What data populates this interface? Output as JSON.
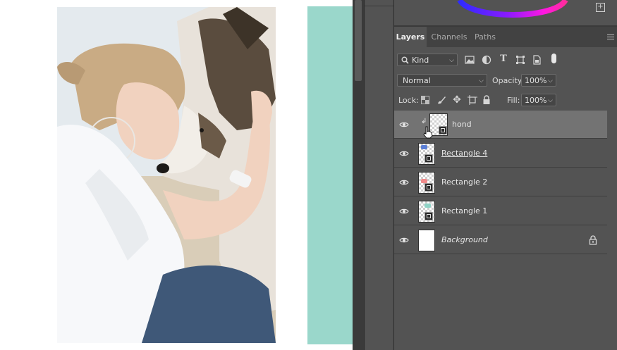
{
  "panel": {
    "tabs": [
      {
        "label": "Layers",
        "active": true
      },
      {
        "label": "Channels",
        "active": false
      },
      {
        "label": "Paths",
        "active": false
      }
    ],
    "filter": {
      "kind_label": "Kind"
    },
    "blend_mode": "Normal",
    "opacity": {
      "label": "Opacity:",
      "value": "100%"
    },
    "lock": {
      "label": "Lock:"
    },
    "fill": {
      "label": "Fill:",
      "value": "100%"
    },
    "layers": [
      {
        "name": "hond",
        "selected": true,
        "clipped": true,
        "icon": "smart-object"
      },
      {
        "name": "Rectangle 4",
        "swatch": "#5b7fd6"
      },
      {
        "name": "Rectangle 2",
        "swatch": "#f08a8a"
      },
      {
        "name": "Rectangle 1",
        "swatch": "#8fd3c6"
      },
      {
        "name": "Background",
        "locked": true
      }
    ]
  },
  "canvas": {
    "accent_rect_color": "#9ad7cb",
    "photo_subject": "woman-with-dog-photo"
  },
  "colors": {
    "panel_bg": "#535353",
    "selected_layer": "#737373",
    "tab_bar": "#424242"
  }
}
